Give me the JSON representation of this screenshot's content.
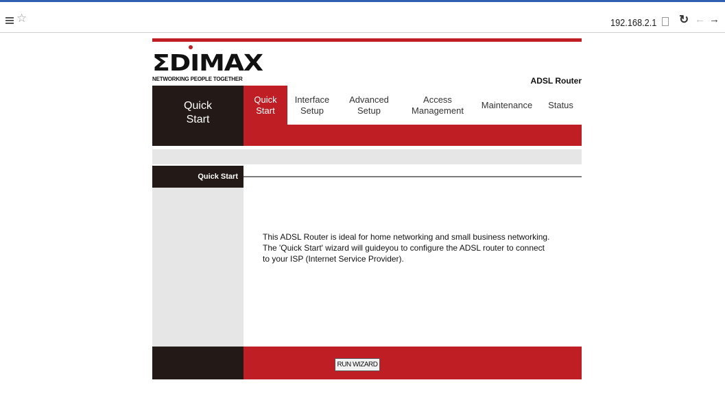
{
  "browser": {
    "url": "192.168.2.1",
    "icons": [
      "menu-icon",
      "star-icon",
      "page-icon",
      "reload-icon",
      "back-arrow-icon",
      "forward-arrow-icon"
    ]
  },
  "header": {
    "logo_text": "ΣDIMAX",
    "tagline": "NETWORKING PEOPLE TOGETHER",
    "product": "ADSL Router"
  },
  "nav": {
    "current_section_line1": "Quick",
    "current_section_line2": "Start",
    "tabs": [
      {
        "line1": "Quick",
        "line2": "Start",
        "active": true
      },
      {
        "line1": "Interface",
        "line2": "Setup",
        "active": false
      },
      {
        "line1": "Advanced",
        "line2": "Setup",
        "active": false
      },
      {
        "line1": "Access",
        "line2": "Management",
        "active": false
      },
      {
        "line1": "Maintenance",
        "line2": "",
        "active": false
      },
      {
        "line1": "Status",
        "line2": "",
        "active": false
      }
    ]
  },
  "section": {
    "title": "Quick Start",
    "description": "This ADSL Router is ideal for home networking and small business networking. The 'Quick Start' wizard will guideyou to configure the ADSL router to connect to your ISP (Internet Service Provider)."
  },
  "footer": {
    "run_wizard_label": "RUN WIZARD"
  },
  "colors": {
    "brand_red": "#be1e24",
    "dark_brown": "#231a17",
    "light_gray": "#e6e6e6"
  }
}
